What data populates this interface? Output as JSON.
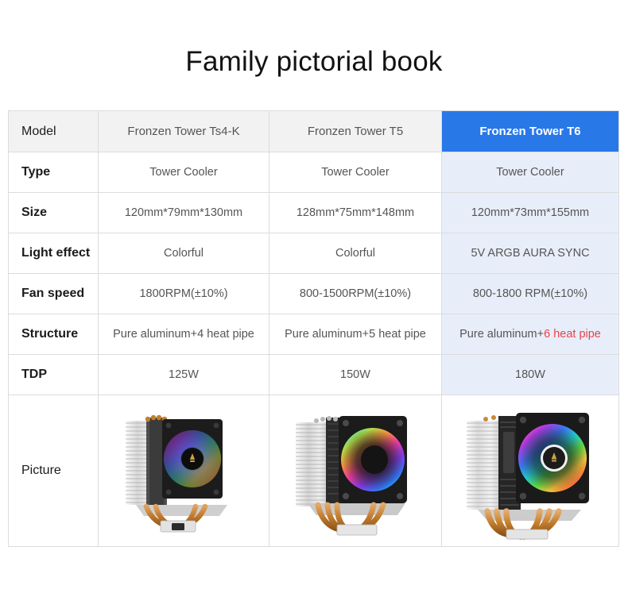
{
  "page": {
    "title": "Family pictorial book"
  },
  "colors": {
    "accent_blue": "#2878e8",
    "highlight_column_bg": "#e8eef9",
    "header_row_bg": "#f2f2f2",
    "accent_red": "#e8424a",
    "border": "#dcdcdc",
    "text_dark": "#1b1b1b",
    "text_gray": "#555555",
    "copper": "#c87d35",
    "aluminum": "#d4d4d4"
  },
  "table": {
    "header": {
      "label": "Model",
      "models": [
        {
          "name": "Fronzen Tower Ts4-K",
          "highlighted": false
        },
        {
          "name": "Fronzen Tower T5",
          "highlighted": false
        },
        {
          "name": "Fronzen Tower T6",
          "highlighted": true
        }
      ]
    },
    "rows": [
      {
        "label": "Type",
        "values": [
          "Tower Cooler",
          "Tower Cooler",
          "Tower Cooler"
        ]
      },
      {
        "label": "Size",
        "values": [
          "120mm*79mm*130mm",
          "128mm*75mm*148mm",
          "120mm*73mm*155mm"
        ]
      },
      {
        "label": "Light effect",
        "values": [
          "Colorful",
          "Colorful",
          "5V ARGB AURA SYNC"
        ]
      },
      {
        "label": "Fan speed",
        "values": [
          "1800RPM(±10%)",
          "800-1500RPM(±10%)",
          "800-1800 RPM(±10%)"
        ]
      },
      {
        "label": "Structure",
        "values": [
          "Pure aluminum+4 heat pipe",
          "Pure aluminum+5 heat pipe",
          "Pure aluminum+"
        ],
        "value_3_accent": "6 heat pipe"
      },
      {
        "label": "TDP",
        "values": [
          "125W",
          "150W",
          "180W"
        ]
      }
    ],
    "picture_row": {
      "label": "Picture",
      "products": [
        {
          "alt": "cpu-cooler-ts4-k",
          "heat_pipes": 4,
          "hub": "black"
        },
        {
          "alt": "cpu-cooler-t5",
          "heat_pipes": 5,
          "hub": "dark"
        },
        {
          "alt": "cpu-cooler-t6",
          "heat_pipes": 6,
          "hub": "white"
        }
      ]
    }
  }
}
